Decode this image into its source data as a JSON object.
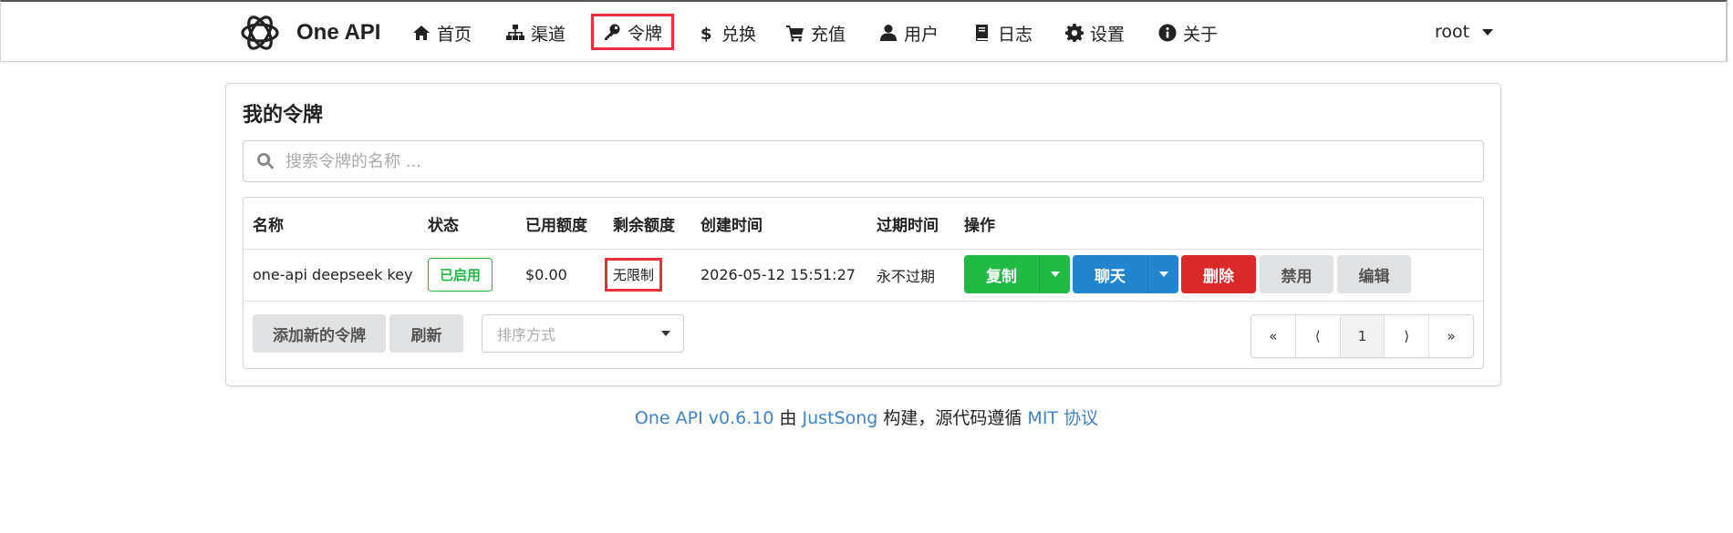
{
  "brand": {
    "name": "One API"
  },
  "nav": [
    {
      "label": "首页",
      "icon": "home-icon"
    },
    {
      "label": "渠道",
      "icon": "sitemap-icon"
    },
    {
      "label": "令牌",
      "icon": "key-icon",
      "active": true
    },
    {
      "label": "兑换",
      "icon": "dollar-icon"
    },
    {
      "label": "充值",
      "icon": "cart-icon"
    },
    {
      "label": "用户",
      "icon": "user-icon"
    },
    {
      "label": "日志",
      "icon": "book-icon"
    },
    {
      "label": "设置",
      "icon": "gear-icon"
    },
    {
      "label": "关于",
      "icon": "info-icon"
    }
  ],
  "user": {
    "name": "root"
  },
  "card": {
    "title": "我的令牌",
    "search_placeholder": "搜索令牌的名称 ..."
  },
  "table": {
    "headers": [
      "名称",
      "状态",
      "已用额度",
      "剩余额度",
      "创建时间",
      "过期时间",
      "操作"
    ],
    "rows": [
      {
        "name": "one-api deepseek key",
        "status": "已启用",
        "used": "$0.00",
        "remaining": "无限制",
        "created": "2026-05-12 15:51:27",
        "expires": "永不过期"
      }
    ],
    "actions": {
      "copy": "复制",
      "chat": "聊天",
      "delete": "删除",
      "disable": "禁用",
      "edit": "编辑"
    }
  },
  "toolbar": {
    "add_label": "添加新的令牌",
    "refresh_label": "刷新",
    "sort_placeholder": "排序方式"
  },
  "pagination": {
    "first": "«",
    "prev": "⟨",
    "page": "1",
    "next": "⟩",
    "last": "»"
  },
  "footer": {
    "app": "One API v0.6.10",
    "by": " 由 ",
    "author": "JustSong",
    "middle": " 构建，源代码遵循 ",
    "license": "MIT 协议"
  },
  "colors": {
    "accent_red": "#e8303a",
    "green": "#21ba45",
    "blue": "#2185d0",
    "red": "#db2828",
    "link": "#4183c4"
  }
}
